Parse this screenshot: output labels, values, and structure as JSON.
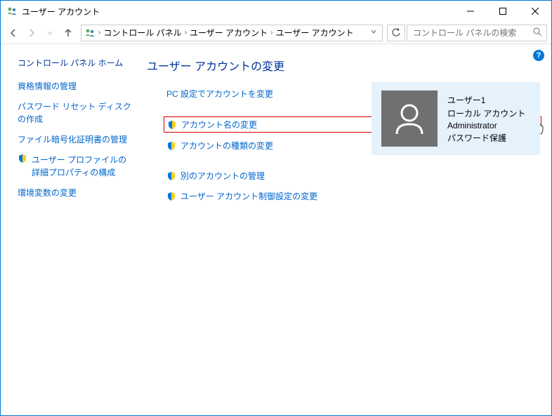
{
  "window": {
    "title": "ユーザー アカウント"
  },
  "breadcrumbs": {
    "item0": "コントロール パネル",
    "item1": "ユーザー アカウント",
    "item2": "ユーザー アカウント"
  },
  "search": {
    "placeholder": "コントロール パネルの検索"
  },
  "sidebar": {
    "heading": "コントロール パネル ホーム",
    "link0": "資格情報の管理",
    "link1": "パスワード リセット ディスクの作成",
    "link2": "ファイル暗号化証明書の管理",
    "link3": "ユーザー プロファイルの詳細プロパティの構成",
    "link4": "環境変数の変更"
  },
  "main": {
    "heading": "ユーザー アカウントの変更",
    "link_pc_settings": "PC 設定でアカウントを変更",
    "link_change_name": "アカウント名の変更",
    "link_change_type": "アカウントの種類の変更",
    "link_manage_other": "別のアカウントの管理",
    "link_uac_settings": "ユーザー アカウント制御設定の変更"
  },
  "account": {
    "name": "ユーザー1",
    "type": "ローカル アカウント",
    "role": "Administrator",
    "protection": "パスワード保護"
  }
}
